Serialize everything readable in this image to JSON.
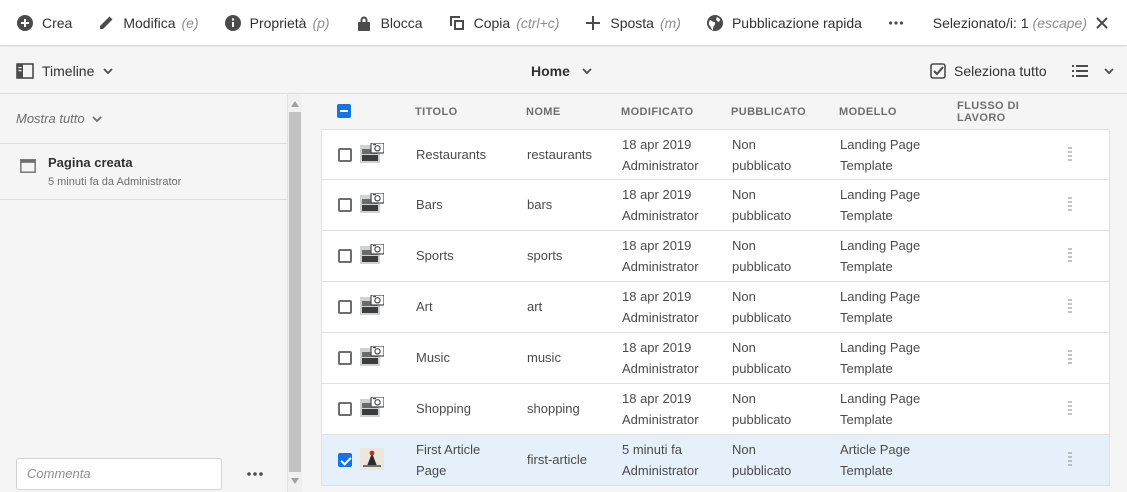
{
  "actionbar": {
    "actions": [
      {
        "label": "Crea",
        "shortcut": "",
        "icon": "plus-circle-icon"
      },
      {
        "label": "Modifica",
        "shortcut": "(e)",
        "icon": "pencil-icon"
      },
      {
        "label": "Proprietà",
        "shortcut": "(p)",
        "icon": "info-icon"
      },
      {
        "label": "Blocca",
        "shortcut": "",
        "icon": "lock-icon"
      },
      {
        "label": "Copia",
        "shortcut": "(ctrl+c)",
        "icon": "copy-icon"
      },
      {
        "label": "Sposta",
        "shortcut": "(m)",
        "icon": "move-icon"
      },
      {
        "label": "Pubblicazione rapida",
        "shortcut": "",
        "icon": "globe-icon"
      }
    ],
    "more_icon": "more-icon",
    "selection_label": "Selezionato/i: 1",
    "selection_shortcut": "(escape)",
    "close_icon": "close-icon"
  },
  "secbar": {
    "rail_label": "Timeline",
    "breadcrumb": "Home",
    "select_all": "Seleziona tutto"
  },
  "rail": {
    "filter": "Mostra tutto",
    "entries": [
      {
        "title": "Pagina creata",
        "subtitle": "5 minuti fa da Administrator"
      }
    ],
    "comment_placeholder": "Commenta"
  },
  "table": {
    "headers": {
      "title": "TITOLO",
      "name": "NOME",
      "modified": "MODIFICATO",
      "published": "PUBBLICATO",
      "template": "MODELLO",
      "workflow": "FLUSSO DI LAVORO"
    },
    "rows": [
      {
        "title": "Restaurants",
        "name": "restaurants",
        "modified": "18 apr 2019",
        "modified_by": "Administrator",
        "pub1": "Non",
        "pub2": "pubblicato",
        "tpl1": "Landing Page",
        "tpl2": "Template",
        "selected": false
      },
      {
        "title": "Bars",
        "name": "bars",
        "modified": "18 apr 2019",
        "modified_by": "Administrator",
        "pub1": "Non",
        "pub2": "pubblicato",
        "tpl1": "Landing Page",
        "tpl2": "Template",
        "selected": false
      },
      {
        "title": "Sports",
        "name": "sports",
        "modified": "18 apr 2019",
        "modified_by": "Administrator",
        "pub1": "Non",
        "pub2": "pubblicato",
        "tpl1": "Landing Page",
        "tpl2": "Template",
        "selected": false
      },
      {
        "title": "Art",
        "name": "art",
        "modified": "18 apr 2019",
        "modified_by": "Administrator",
        "pub1": "Non",
        "pub2": "pubblicato",
        "tpl1": "Landing Page",
        "tpl2": "Template",
        "selected": false
      },
      {
        "title": "Music",
        "name": "music",
        "modified": "18 apr 2019",
        "modified_by": "Administrator",
        "pub1": "Non",
        "pub2": "pubblicato",
        "tpl1": "Landing Page",
        "tpl2": "Template",
        "selected": false
      },
      {
        "title": "Shopping",
        "name": "shopping",
        "modified": "18 apr 2019",
        "modified_by": "Administrator",
        "pub1": "Non",
        "pub2": "pubblicato",
        "tpl1": "Landing Page",
        "tpl2": "Template",
        "selected": false
      },
      {
        "title": "First Article Page",
        "title1": "First Article",
        "title2": "Page",
        "name": "first-article",
        "modified": "5 minuti fa",
        "modified_by": "Administrator",
        "pub1": "Non",
        "pub2": "pubblicato",
        "tpl1": "Article Page",
        "tpl2": "Template",
        "selected": true
      }
    ]
  },
  "colors": {
    "accent": "#1473e6",
    "selected_row": "#e6f0fb"
  }
}
